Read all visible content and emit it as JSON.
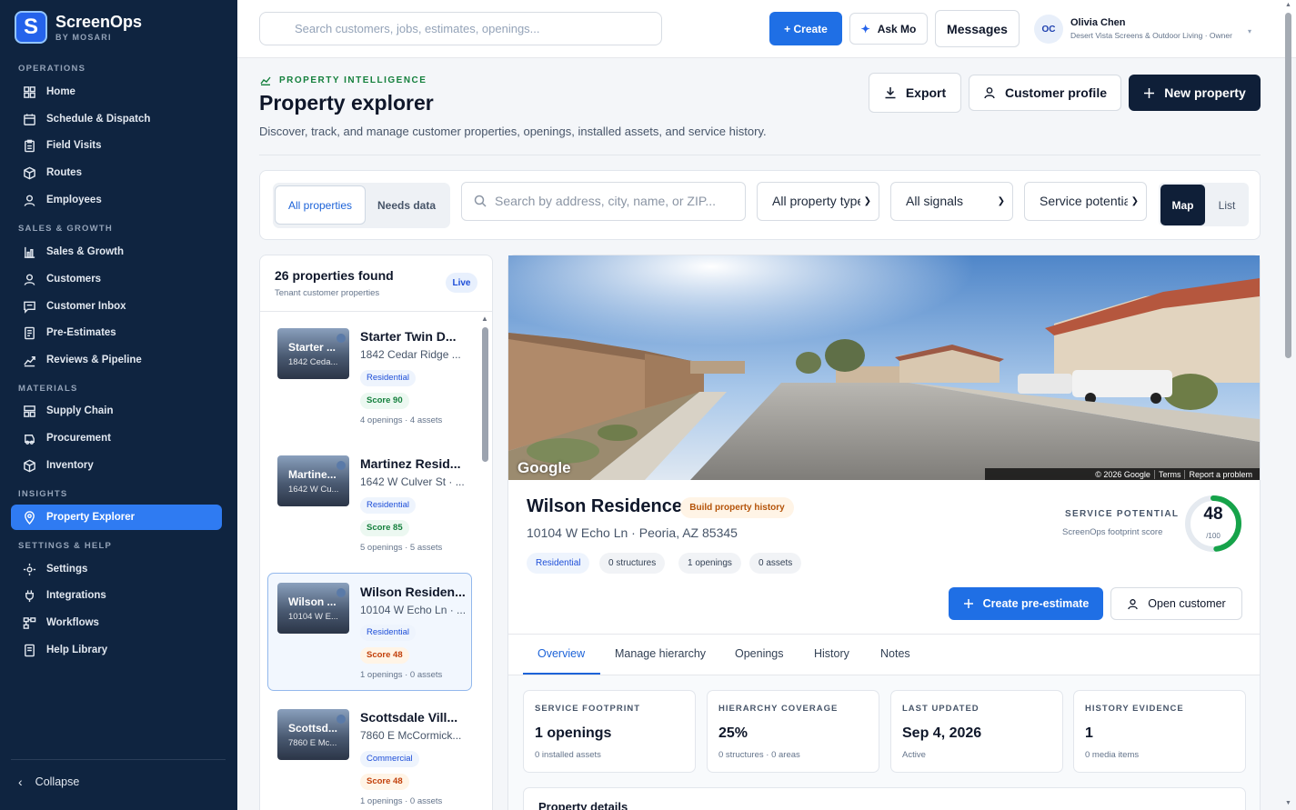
{
  "brand": {
    "name": "ScreenOps",
    "sub": "BY MOSARI",
    "logo_letter": "S"
  },
  "sidebar": {
    "sections": [
      {
        "label": "OPERATIONS"
      },
      {
        "label": "SALES & GROWTH"
      },
      {
        "label": "MATERIALS"
      },
      {
        "label": "INSIGHTS"
      },
      {
        "label": "SETTINGS & HELP"
      }
    ],
    "items": [
      {
        "label": "Home",
        "icon": "grid-icon"
      },
      {
        "label": "Schedule & Dispatch",
        "icon": "calendar-icon"
      },
      {
        "label": "Field Visits",
        "icon": "clipboard-icon"
      },
      {
        "label": "Routes",
        "icon": "box-icon"
      },
      {
        "label": "Employees",
        "icon": "user-icon"
      },
      {
        "label": "Sales & Growth",
        "icon": "bar-chart-icon"
      },
      {
        "label": "Customers",
        "icon": "user-icon"
      },
      {
        "label": "Customer Inbox",
        "icon": "message-icon"
      },
      {
        "label": "Pre-Estimates",
        "icon": "document-icon"
      },
      {
        "label": "Reviews & Pipeline",
        "icon": "trend-icon"
      },
      {
        "label": "Supply Chain",
        "icon": "grid-icon"
      },
      {
        "label": "Procurement",
        "icon": "truck-icon"
      },
      {
        "label": "Inventory",
        "icon": "box-icon"
      },
      {
        "label": "Property Explorer",
        "icon": "map-pin-icon"
      },
      {
        "label": "Settings",
        "icon": "gear-icon"
      },
      {
        "label": "Integrations",
        "icon": "plug-icon"
      },
      {
        "label": "Workflows",
        "icon": "workflow-icon"
      },
      {
        "label": "Help Library",
        "icon": "book-icon"
      }
    ],
    "collapse_label": "Collapse"
  },
  "topbar": {
    "search_placeholder": "Search customers, jobs, estimates, openings...",
    "create_label": "+ Create",
    "askmo_label": "Ask Mo",
    "messages_label": "Messages",
    "user": {
      "initials": "OC",
      "name": "Olivia Chen",
      "org": "Desert Vista Screens & Outdoor Living · Owner"
    }
  },
  "header": {
    "eyebrow": "PROPERTY INTELLIGENCE",
    "title": "Property explorer",
    "subtitle": "Discover, track, and manage customer properties, openings, installed assets, and service history.",
    "export_label": "Export",
    "profile_label": "Customer profile",
    "new_label": "New property"
  },
  "filters": {
    "seg_all": "All properties",
    "seg_needs": "Needs data",
    "search_placeholder": "Search by address, city, name, or ZIP...",
    "type_select": "All property types",
    "signals_select": "All signals",
    "potential_select": "Service potential",
    "view_map": "Map",
    "view_list": "List"
  },
  "list": {
    "title": "26 properties found",
    "subtitle": "Tenant customer properties",
    "badge": "Live",
    "items": [
      {
        "name": "Starter Twin D...",
        "thumb_name": "Starter ...",
        "thumb_addr": "1842 Ceda...",
        "addr": "1842 Cedar Ridge ...",
        "type": "Residential",
        "score": "Score 90",
        "meta": "4 openings · 4 assets"
      },
      {
        "name": "Martinez Resid...",
        "thumb_name": "Martine...",
        "thumb_addr": "1642 W Cu...",
        "addr": "1642 W Culver St · ...",
        "type": "Residential",
        "score": "Score 85",
        "meta": "5 openings · 5 assets"
      },
      {
        "name": "Wilson Residen...",
        "thumb_name": "Wilson ...",
        "thumb_addr": "10104 W E...",
        "addr": "10104 W Echo Ln · ...",
        "type": "Residential",
        "score": "Score 48",
        "meta": "1 openings · 0 assets"
      },
      {
        "name": "Scottsdale Vill...",
        "thumb_name": "Scottsd...",
        "thumb_addr": "7860 E Mc...",
        "addr": "7860 E McCormick...",
        "type": "Commercial",
        "score": "Score 48",
        "meta": "1 openings · 0 assets"
      }
    ]
  },
  "detail": {
    "map_logo": "Google",
    "attribution": [
      "© 2026 Google",
      "Terms",
      "Report a problem"
    ],
    "name": "Wilson Residence",
    "warning": "Build property history",
    "address": "10104 W Echo Ln · Peoria, AZ 85345",
    "chips": [
      "Residential",
      "0 structures",
      "1 openings",
      "0 assets"
    ],
    "service_label": "SERVICE POTENTIAL",
    "service_sub": "ScreenOps footprint score",
    "score": 48,
    "score_den": "/100",
    "preestimate_label": "Create pre-estimate",
    "opencust_label": "Open customer",
    "tabs": [
      "Overview",
      "Manage hierarchy",
      "Openings",
      "History",
      "Notes"
    ],
    "stats": [
      {
        "label": "SERVICE FOOTPRINT",
        "value": "1 openings",
        "note": "0 installed assets"
      },
      {
        "label": "HIERARCHY COVERAGE",
        "value": "25%",
        "note": "0 structures · 0 areas"
      },
      {
        "label": "LAST UPDATED",
        "value": "Sep 4, 2026",
        "note": "Active"
      },
      {
        "label": "HISTORY EVIDENCE",
        "value": "1",
        "note": "0 media items"
      }
    ],
    "details_title": "Property details"
  },
  "colors": {
    "sidebar_bg": "#0f2440",
    "accent": "#1f6fe5",
    "active_nav": "#2f7bf2",
    "score_ring": "#16a34a"
  }
}
